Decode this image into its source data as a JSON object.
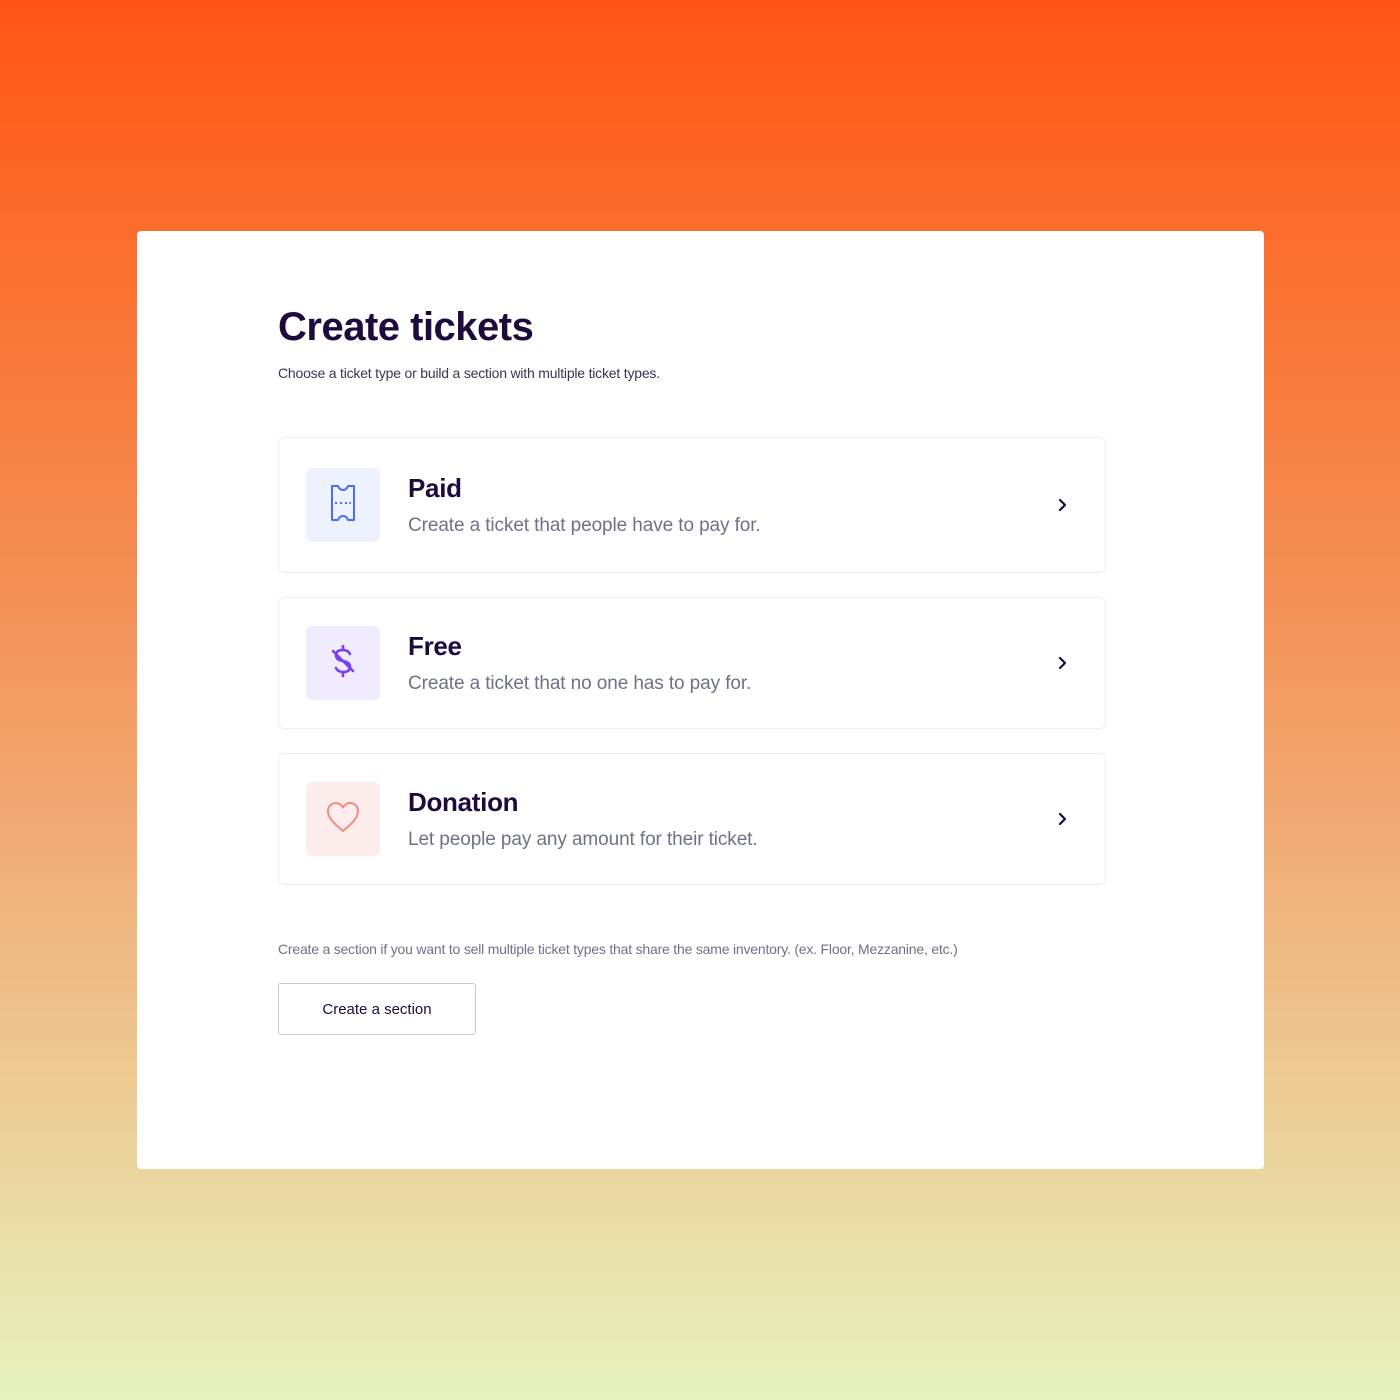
{
  "header": {
    "title": "Create tickets",
    "subtitle": "Choose a ticket type or build a section with multiple ticket types."
  },
  "ticket_options": [
    {
      "title": "Paid",
      "description": "Create a ticket that people have to pay for.",
      "icon": "ticket-icon",
      "icon_color": "#4a6cf7",
      "icon_bg": "#eef2ff"
    },
    {
      "title": "Free",
      "description": "Create a ticket that no one has to pay for.",
      "icon": "no-dollar-icon",
      "icon_color": "#7b3ff2",
      "icon_bg": "#f1ebff"
    },
    {
      "title": "Donation",
      "description": "Let people pay any amount for their ticket.",
      "icon": "heart-icon",
      "icon_color": "#f28b82",
      "icon_bg": "#fdecec"
    }
  ],
  "section": {
    "hint": "Create a section if you want to sell multiple ticket types that share the same inventory. (ex. Floor, Mezzanine, etc.)",
    "button_label": "Create a section"
  },
  "colors": {
    "title": "#1e0a3c",
    "muted": "#6f7287",
    "background_top": "#ff5414",
    "background_bottom": "#e6f3c0"
  }
}
